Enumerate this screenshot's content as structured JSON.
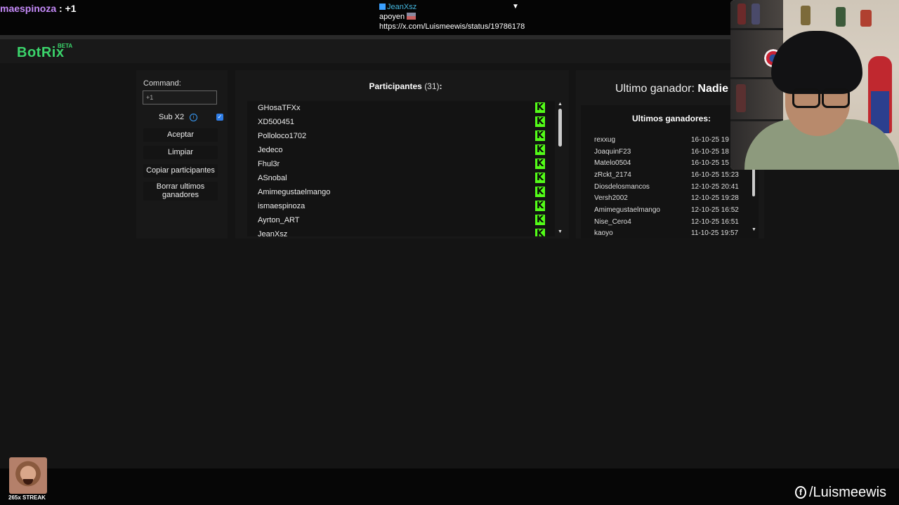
{
  "chat": {
    "user": "maespinoza",
    "message": " : +1"
  },
  "pinned": {
    "user": "JeanXsz",
    "message": "apoyen",
    "url": "https://x.com/Luismeewis/status/19786178"
  },
  "app": {
    "logo": "BotRix",
    "beta": "BETA"
  },
  "controls": {
    "command_label": "Command:",
    "command_value": "+1",
    "sub_label": "Sub X2",
    "accept": "Aceptar",
    "clear": "Limpiar",
    "copy": "Copiar participantes",
    "erase": "Borrar ultimos ganadores"
  },
  "participants": {
    "title": "Participantes",
    "count": "(31)",
    "colon": ":",
    "items": [
      "GHosaTFXx",
      "XD500451",
      "Polloloco1702",
      "Jedeco",
      "Fhul3r",
      "ASnobal",
      "Amimegustaelmango",
      "ismaespinoza",
      "Ayrton_ART",
      "JeanXsz"
    ]
  },
  "winners": {
    "last_label": "Ultimo ganador:",
    "last_value": "Nadie",
    "title": "Ultimos ganadores:",
    "items": [
      {
        "name": "rexxug",
        "date": "16-10-25 19"
      },
      {
        "name": "JoaquinF23",
        "date": "16-10-25 18"
      },
      {
        "name": "Matelo0504",
        "date": "16-10-25 15"
      },
      {
        "name": "zRckt_2174",
        "date": "16-10-25 15:23"
      },
      {
        "name": "Diosdelosmancos",
        "date": "12-10-25 20:41"
      },
      {
        "name": "Versh2002",
        "date": "12-10-25 19:28"
      },
      {
        "name": "Amimegustaelmango",
        "date": "12-10-25 16:52"
      },
      {
        "name": "Nise_Cero4",
        "date": "12-10-25 16:51"
      },
      {
        "name": "kaoyo",
        "date": "11-10-25 19:57"
      }
    ]
  },
  "overlay": {
    "streak": "265x STREAK",
    "social": "/Luismeewis"
  },
  "colors": {
    "brand": "#3bd46b",
    "kick": "#53fc18",
    "chat_user": "#c58af9",
    "pinned_user": "#45b8e0"
  }
}
